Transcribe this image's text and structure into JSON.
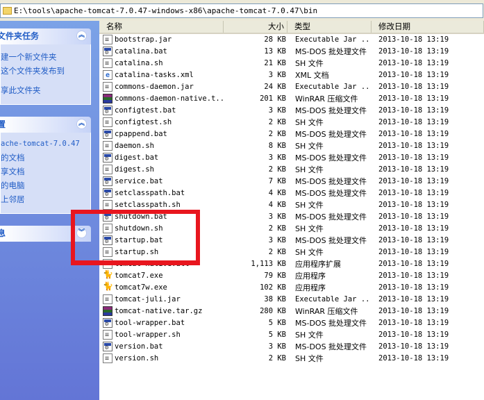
{
  "address": {
    "path": "E:\\tools\\apache-tomcat-7.0.47-windows-x86\\apache-tomcat-7.0.47\\bin"
  },
  "taskpane": {
    "file_tasks": {
      "title": "文件夹任务",
      "items": [
        "建一个新文件夹",
        "这个文件夹发布到",
        "享此文件夹"
      ]
    },
    "other_places": {
      "title": "置",
      "items": [
        "ache-tomcat-7.0.47",
        "的文档",
        "享文档",
        "的电脑",
        "上邻居"
      ]
    },
    "details": {
      "title": "息"
    }
  },
  "columns": {
    "name": "名称",
    "size": "大小",
    "type": "类型",
    "date": "修改日期"
  },
  "files": [
    {
      "name": "bootstrap.jar",
      "size": "28 KB",
      "type": "Executable Jar ...",
      "date": "2013-10-18 13:19",
      "icon": "document-icon"
    },
    {
      "name": "catalina.bat",
      "size": "13 KB",
      "type": "MS-DOS 批处理文件",
      "date": "2013-10-18 13:19",
      "icon": "batch-file-icon"
    },
    {
      "name": "catalina.sh",
      "size": "21 KB",
      "type": "SH 文件",
      "date": "2013-10-18 13:19",
      "icon": "document-icon"
    },
    {
      "name": "catalina-tasks.xml",
      "size": "3 KB",
      "type": "XML 文档",
      "date": "2013-10-18 13:19",
      "icon": "xml-file-icon"
    },
    {
      "name": "commons-daemon.jar",
      "size": "24 KB",
      "type": "Executable Jar ...",
      "date": "2013-10-18 13:19",
      "icon": "document-icon"
    },
    {
      "name": "commons-daemon-native.t...",
      "size": "201 KB",
      "type": "WinRAR 压缩文件",
      "date": "2013-10-18 13:19",
      "icon": "rar-archive-icon"
    },
    {
      "name": "configtest.bat",
      "size": "3 KB",
      "type": "MS-DOS 批处理文件",
      "date": "2013-10-18 13:19",
      "icon": "batch-file-icon"
    },
    {
      "name": "configtest.sh",
      "size": "2 KB",
      "type": "SH 文件",
      "date": "2013-10-18 13:19",
      "icon": "document-icon"
    },
    {
      "name": "cpappend.bat",
      "size": "2 KB",
      "type": "MS-DOS 批处理文件",
      "date": "2013-10-18 13:19",
      "icon": "batch-file-icon"
    },
    {
      "name": "daemon.sh",
      "size": "8 KB",
      "type": "SH 文件",
      "date": "2013-10-18 13:19",
      "icon": "document-icon"
    },
    {
      "name": "digest.bat",
      "size": "3 KB",
      "type": "MS-DOS 批处理文件",
      "date": "2013-10-18 13:19",
      "icon": "batch-file-icon"
    },
    {
      "name": "digest.sh",
      "size": "2 KB",
      "type": "SH 文件",
      "date": "2013-10-18 13:19",
      "icon": "document-icon"
    },
    {
      "name": "service.bat",
      "size": "7 KB",
      "type": "MS-DOS 批处理文件",
      "date": "2013-10-18 13:19",
      "icon": "batch-file-icon"
    },
    {
      "name": "setclasspath.bat",
      "size": "4 KB",
      "type": "MS-DOS 批处理文件",
      "date": "2013-10-18 13:19",
      "icon": "batch-file-icon"
    },
    {
      "name": "setclasspath.sh",
      "size": "4 KB",
      "type": "SH 文件",
      "date": "2013-10-18 13:19",
      "icon": "document-icon"
    },
    {
      "name": "shutdown.bat",
      "size": "3 KB",
      "type": "MS-DOS 批处理文件",
      "date": "2013-10-18 13:19",
      "icon": "batch-file-icon"
    },
    {
      "name": "shutdown.sh",
      "size": "2 KB",
      "type": "SH 文件",
      "date": "2013-10-18 13:19",
      "icon": "document-icon"
    },
    {
      "name": "startup.bat",
      "size": "3 KB",
      "type": "MS-DOS 批处理文件",
      "date": "2013-10-18 13:19",
      "icon": "batch-file-icon"
    },
    {
      "name": "startup.sh",
      "size": "2 KB",
      "type": "SH 文件",
      "date": "2013-10-18 13:19",
      "icon": "document-icon"
    },
    {
      "name": "tomcat-native.dll",
      "size": "1,113 KB",
      "type": "应用程序扩展",
      "date": "2013-10-18 13:19",
      "icon": "dll-file-icon"
    },
    {
      "name": "tomcat7.exe",
      "size": "79 KB",
      "type": "应用程序",
      "date": "2013-10-18 13:19",
      "icon": "tomcat-exe-icon"
    },
    {
      "name": "tomcat7w.exe",
      "size": "102 KB",
      "type": "应用程序",
      "date": "2013-10-18 13:19",
      "icon": "tomcat-exe-icon"
    },
    {
      "name": "tomcat-juli.jar",
      "size": "38 KB",
      "type": "Executable Jar ...",
      "date": "2013-10-18 13:19",
      "icon": "document-icon"
    },
    {
      "name": "tomcat-native.tar.gz",
      "size": "280 KB",
      "type": "WinRAR 压缩文件",
      "date": "2013-10-18 13:19",
      "icon": "rar-archive-icon"
    },
    {
      "name": "tool-wrapper.bat",
      "size": "5 KB",
      "type": "MS-DOS 批处理文件",
      "date": "2013-10-18 13:19",
      "icon": "batch-file-icon"
    },
    {
      "name": "tool-wrapper.sh",
      "size": "5 KB",
      "type": "SH 文件",
      "date": "2013-10-18 13:19",
      "icon": "document-icon"
    },
    {
      "name": "version.bat",
      "size": "3 KB",
      "type": "MS-DOS 批处理文件",
      "date": "2013-10-18 13:19",
      "icon": "batch-file-icon"
    },
    {
      "name": "version.sh",
      "size": "2 KB",
      "type": "SH 文件",
      "date": "2013-10-18 13:19",
      "icon": "document-icon"
    }
  ],
  "highlight_color": "#e8161e"
}
